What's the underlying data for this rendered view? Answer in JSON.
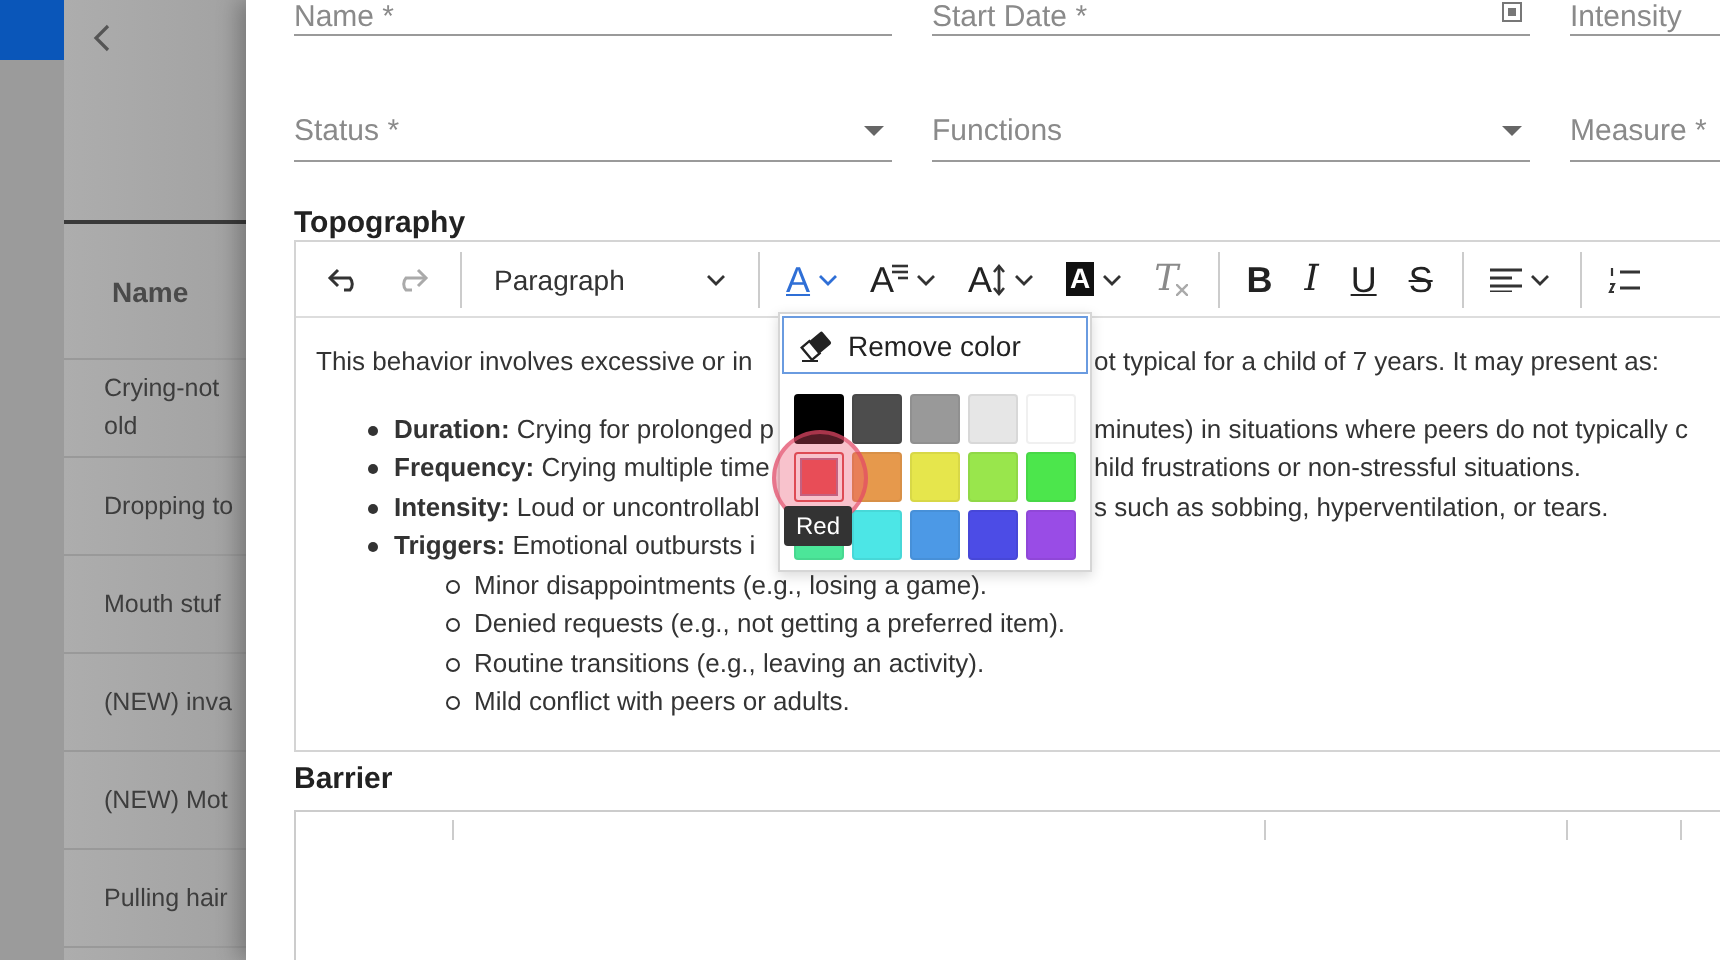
{
  "backdrop": {
    "table": {
      "header": "Name",
      "rows": [
        "Crying-not old",
        "Dropping to",
        "Mouth stuf",
        "(NEW) inva",
        "(NEW) Mot",
        "Pulling hair"
      ]
    }
  },
  "form": {
    "rows": [
      [
        {
          "label": "Name *",
          "kind": "text"
        },
        {
          "label": "Start Date *",
          "kind": "date"
        },
        {
          "label": "Intensity",
          "kind": "text"
        }
      ],
      [
        {
          "label": "Status *",
          "kind": "select"
        },
        {
          "label": "Functions",
          "kind": "select"
        },
        {
          "label": "Measure *",
          "kind": "text"
        }
      ]
    ],
    "topography": {
      "heading": "Topography",
      "toolbar": [
        {
          "kind": "undo",
          "disabled": false
        },
        {
          "kind": "redo",
          "disabled": true
        },
        {
          "kind": "separator"
        },
        {
          "kind": "dropdown",
          "label": "Paragraph"
        },
        {
          "kind": "separator"
        },
        {
          "kind": "font-color",
          "glyph": "A",
          "disabled": false
        },
        {
          "kind": "font-family",
          "glyph": "A",
          "disabled": false
        },
        {
          "kind": "font-size",
          "glyph": "A",
          "disabled": false
        },
        {
          "kind": "highlight",
          "glyph": "A",
          "disabled": false
        },
        {
          "kind": "clear-format",
          "glyph": "T",
          "disabled": true
        },
        {
          "kind": "separator"
        },
        {
          "kind": "bold",
          "glyph": "B",
          "disabled": false
        },
        {
          "kind": "italic",
          "glyph": "I",
          "disabled": false
        },
        {
          "kind": "underline",
          "glyph": "U",
          "disabled": false
        },
        {
          "kind": "strike",
          "glyph": "S",
          "disabled": false
        },
        {
          "kind": "separator"
        },
        {
          "kind": "align"
        },
        {
          "kind": "separator"
        },
        {
          "kind": "numbered-list"
        }
      ],
      "intro": {
        "left": "This behavior involves excessive or in",
        "right": "ot typical for a child of 7 years. It may present as:"
      },
      "bullets": [
        {
          "left": "**Duration:** Crying for prolonged p",
          "right": "minutes) in situations where peers do not typically c"
        },
        {
          "left": "**Frequency:** Crying multiple time",
          "right": "hild frustrations or non-stressful situations."
        },
        {
          "left": "**Intensity:** Loud or uncontrollabl",
          "right": "s such as sobbing, hyperventilation, or tears."
        },
        {
          "left": "**Triggers:** Emotional outbursts i",
          "children": [
            "Minor disappointments (e.g., losing a game).",
            "Denied requests (e.g., not getting a preferred item).",
            "Routine transitions (e.g., leaving an activity).",
            "Mild conflict with peers or adults."
          ]
        }
      ],
      "popup": {
        "remove_label": "Remove color",
        "tooltip": "Red",
        "swatches": [
          {
            "color": "#000000",
            "selected": false
          },
          {
            "color": "#4d4d4d",
            "selected": false
          },
          {
            "color": "#999999",
            "selected": false
          },
          {
            "color": "#e6e6e6",
            "selected": false
          },
          {
            "color": "#ffffff",
            "selected": false
          },
          {
            "color": "#e64c4c",
            "selected": true
          },
          {
            "color": "#e6994c",
            "selected": false
          },
          {
            "color": "#e6e64c",
            "selected": false
          },
          {
            "color": "#99e64c",
            "selected": false
          },
          {
            "color": "#4ce64c",
            "selected": false
          },
          {
            "color": "#4ce699",
            "selected": false
          },
          {
            "color": "#4ce6e6",
            "selected": false
          },
          {
            "color": "#4c99e6",
            "selected": false
          },
          {
            "color": "#4c4ce6",
            "selected": false
          },
          {
            "color": "#994ce6",
            "selected": false
          }
        ]
      }
    },
    "barrier": {
      "heading": "Barrier"
    }
  }
}
